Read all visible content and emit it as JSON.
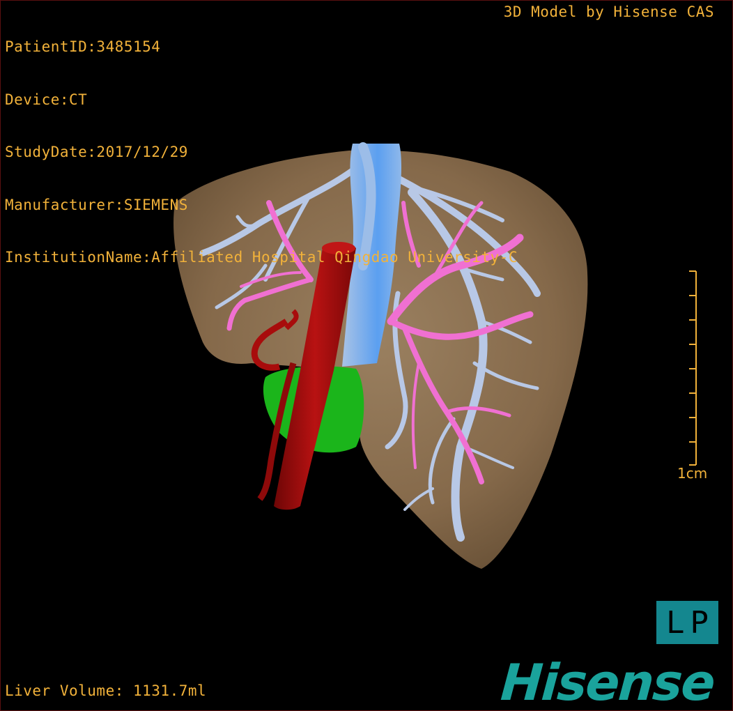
{
  "meta": {
    "patient_id": "PatientID:3485154",
    "device": "Device:CT",
    "study_date": "StudyDate:2017/12/29",
    "manufacturer": "Manufacturer:SIEMENS",
    "institution": "InstitutionName:Affiliated Hospital Qingdao University-C"
  },
  "model_credit": "3D Model by Hisense CAS",
  "liver_volume": "Liver Volume: 1131.7ml",
  "scale": {
    "label": "1cm"
  },
  "orientation": "LP",
  "brand": "Hisense",
  "colors": {
    "overlay_text": "#f2b23a",
    "liver": "#8b7354",
    "hepatic_vein": "#b8c8e6",
    "portal_vein": "#f070d2",
    "ivc": "#6aa8ee",
    "aorta": "#a80c0c",
    "gallbladder": "#1bb51b",
    "brand": "#1aa39c"
  }
}
